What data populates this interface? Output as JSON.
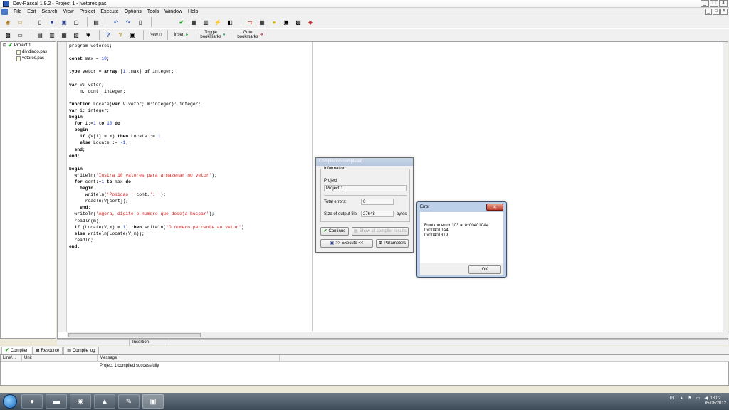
{
  "window": {
    "title": "Dev-Pascal 1.9.2 - Project 1 - [vetores.pas]",
    "buttons": [
      "_",
      "□",
      "X"
    ],
    "mdi_buttons": [
      "_",
      "□",
      "X"
    ]
  },
  "menu": [
    "File",
    "Edit",
    "Search",
    "View",
    "Project",
    "Execute",
    "Options",
    "Tools",
    "Window",
    "Help"
  ],
  "toolbar2": {
    "new_label": "New",
    "insert_label": "Insert",
    "toggle_bookmarks_label_1": "Toggle",
    "toggle_bookmarks_label_2": "bookmarks",
    "goto_bookmarks_label_1": "Goto",
    "goto_bookmarks_label_2": "bookmarks"
  },
  "project_tree": {
    "root": "Project 1",
    "files": [
      "dividindo.pas",
      "vetores.pas"
    ]
  },
  "editor": {
    "lines": [
      [
        {
          "t": "program vetores;",
          "c": ""
        }
      ],
      [
        {
          "t": "",
          "c": ""
        }
      ],
      [
        {
          "t": "const",
          "c": "kw"
        },
        {
          "t": " max = ",
          "c": ""
        },
        {
          "t": "10",
          "c": "num"
        },
        {
          "t": ";",
          "c": ""
        }
      ],
      [
        {
          "t": "",
          "c": ""
        }
      ],
      [
        {
          "t": "type",
          "c": "kw"
        },
        {
          "t": " vetor = ",
          "c": ""
        },
        {
          "t": "array",
          "c": "kw"
        },
        {
          "t": " [",
          "c": ""
        },
        {
          "t": "1",
          "c": "num"
        },
        {
          "t": "..max] ",
          "c": ""
        },
        {
          "t": "of",
          "c": "kw"
        },
        {
          "t": " integer;",
          "c": ""
        }
      ],
      [
        {
          "t": "",
          "c": ""
        }
      ],
      [
        {
          "t": "var",
          "c": "kw"
        },
        {
          "t": " V: vetor;",
          "c": ""
        }
      ],
      [
        {
          "t": "    m, cont: integer;",
          "c": ""
        }
      ],
      [
        {
          "t": "",
          "c": ""
        }
      ],
      [
        {
          "t": "function",
          "c": "kw"
        },
        {
          "t": " Locate(",
          "c": ""
        },
        {
          "t": "var",
          "c": "kw"
        },
        {
          "t": " V:vetor; m:integer): integer;",
          "c": ""
        }
      ],
      [
        {
          "t": "var",
          "c": "kw"
        },
        {
          "t": " i: integer;",
          "c": ""
        }
      ],
      [
        {
          "t": "begin",
          "c": "kw"
        }
      ],
      [
        {
          "t": "  ",
          "c": ""
        },
        {
          "t": "for",
          "c": "kw"
        },
        {
          "t": " i:=",
          "c": ""
        },
        {
          "t": "1",
          "c": "num"
        },
        {
          "t": " ",
          "c": ""
        },
        {
          "t": "to",
          "c": "kw"
        },
        {
          "t": " ",
          "c": ""
        },
        {
          "t": "10",
          "c": "num"
        },
        {
          "t": " ",
          "c": ""
        },
        {
          "t": "do",
          "c": "kw"
        }
      ],
      [
        {
          "t": "  ",
          "c": ""
        },
        {
          "t": "begin",
          "c": "kw"
        }
      ],
      [
        {
          "t": "    ",
          "c": ""
        },
        {
          "t": "if",
          "c": "kw"
        },
        {
          "t": " (V[i] = m) ",
          "c": ""
        },
        {
          "t": "then",
          "c": "kw"
        },
        {
          "t": " Locate := ",
          "c": ""
        },
        {
          "t": "1",
          "c": "num"
        }
      ],
      [
        {
          "t": "    ",
          "c": ""
        },
        {
          "t": "else",
          "c": "kw"
        },
        {
          "t": " Locate := ",
          "c": ""
        },
        {
          "t": "-1",
          "c": "num"
        },
        {
          "t": ";",
          "c": ""
        }
      ],
      [
        {
          "t": "  ",
          "c": ""
        },
        {
          "t": "end",
          "c": "kw"
        },
        {
          "t": ";",
          "c": ""
        }
      ],
      [
        {
          "t": "end",
          "c": "kw"
        },
        {
          "t": ";",
          "c": ""
        }
      ],
      [
        {
          "t": "",
          "c": ""
        }
      ],
      [
        {
          "t": "begin",
          "c": "kw"
        }
      ],
      [
        {
          "t": "  writeln(",
          "c": ""
        },
        {
          "t": "'Insira 10 valores para armazenar no vetor'",
          "c": "str"
        },
        {
          "t": ");",
          "c": ""
        }
      ],
      [
        {
          "t": "  ",
          "c": ""
        },
        {
          "t": "for",
          "c": "kw"
        },
        {
          "t": " cont:=",
          "c": ""
        },
        {
          "t": "1",
          "c": "num"
        },
        {
          "t": " ",
          "c": ""
        },
        {
          "t": "to",
          "c": "kw"
        },
        {
          "t": " max ",
          "c": ""
        },
        {
          "t": "do",
          "c": "kw"
        }
      ],
      [
        {
          "t": "    ",
          "c": ""
        },
        {
          "t": "begin",
          "c": "kw"
        }
      ],
      [
        {
          "t": "      writeln(",
          "c": ""
        },
        {
          "t": "'Posicao '",
          "c": "str"
        },
        {
          "t": ",cont,",
          "c": ""
        },
        {
          "t": "': '",
          "c": "str"
        },
        {
          "t": ");",
          "c": ""
        }
      ],
      [
        {
          "t": "      readln(V[cont]);",
          "c": ""
        }
      ],
      [
        {
          "t": "    ",
          "c": ""
        },
        {
          "t": "end",
          "c": "kw"
        },
        {
          "t": ";",
          "c": ""
        }
      ],
      [
        {
          "t": "  writeln(",
          "c": ""
        },
        {
          "t": "'Agora, digite o numero que deseja buscar'",
          "c": "str"
        },
        {
          "t": ");",
          "c": ""
        }
      ],
      [
        {
          "t": "  readln(m);",
          "c": ""
        }
      ],
      [
        {
          "t": "  ",
          "c": ""
        },
        {
          "t": "if",
          "c": "kw"
        },
        {
          "t": " (Locate(V,m) = ",
          "c": ""
        },
        {
          "t": "1",
          "c": "num"
        },
        {
          "t": ") ",
          "c": ""
        },
        {
          "t": "then",
          "c": "kw"
        },
        {
          "t": " writeln(",
          "c": ""
        },
        {
          "t": "'O numero percente ao vetor'",
          "c": "str"
        },
        {
          "t": ")",
          "c": ""
        }
      ],
      [
        {
          "t": "  ",
          "c": ""
        },
        {
          "t": "else",
          "c": "kw"
        },
        {
          "t": " writeln(Locate(V,m));",
          "c": ""
        }
      ],
      [
        {
          "t": "  readln;",
          "c": ""
        }
      ],
      [
        {
          "t": "end",
          "c": "kw"
        },
        {
          "t": ".",
          "c": ""
        }
      ]
    ]
  },
  "status": {
    "mode": "Insertion"
  },
  "bottom_tabs": [
    "Compiler",
    "Resource",
    "Compile log"
  ],
  "messages": {
    "columns": [
      "Line/...",
      "Unit",
      "Message"
    ],
    "rows": [
      {
        "line": "",
        "unit": "",
        "message": "Project 1 compiled successfully"
      }
    ]
  },
  "compile_dialog": {
    "title": "Compilation completed",
    "group_label": "Information:",
    "project_label": "Project",
    "project_value": "Project 1",
    "errors_label": "Total errors:",
    "errors_value": "0",
    "size_label": "Size of output file:",
    "size_value": "27648",
    "size_unit": "bytes",
    "continue_label": "Continue",
    "show_results_label": "Show all compiler results",
    "execute_label": ">> Execute <<",
    "parameters_label": "Parameters"
  },
  "error_dialog": {
    "title": "Error",
    "line1": "Runtime error 103 at 0x004010A4",
    "line2": "  0x004010A4",
    "line3": "  0x00401319",
    "ok_label": "OK"
  },
  "taskbar": {
    "tray_lang": "PT",
    "time": "18:02",
    "date": "05/08/2012"
  },
  "colors": {
    "keyword": "#000000",
    "number": "#1838d8",
    "string": "#d81818",
    "check_green": "#1a9a1a"
  }
}
